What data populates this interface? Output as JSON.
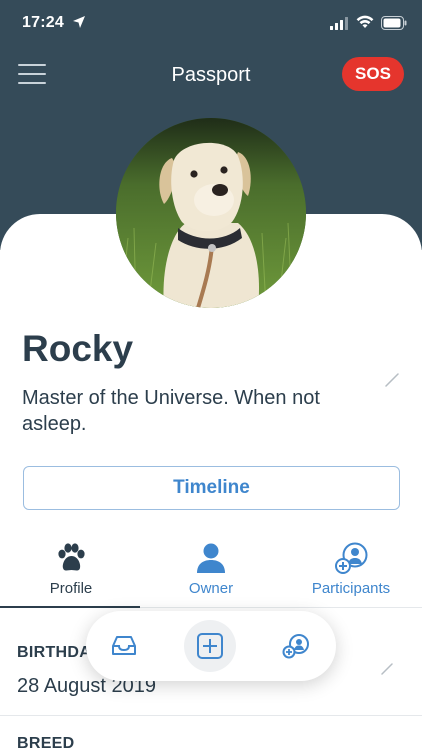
{
  "status_bar": {
    "time": "17:24"
  },
  "nav": {
    "title": "Passport",
    "sos_label": "SOS"
  },
  "pet": {
    "name": "Rocky",
    "bio": "Master of the Universe. When not asleep."
  },
  "timeline_label": "Timeline",
  "tabs": [
    {
      "label": "Profile",
      "icon": "paw-icon",
      "active": true
    },
    {
      "label": "Owner",
      "icon": "person-icon",
      "active": false
    },
    {
      "label": "Participants",
      "icon": "add-person-icon",
      "active": false
    }
  ],
  "details": {
    "birthday_label": "BIRTHDAY",
    "birthday_value": "28 August 2019",
    "breed_label": "BREED"
  },
  "floating_bar": {
    "items": [
      "inbox-icon",
      "add-square-icon",
      "add-participant-icon"
    ]
  },
  "colors": {
    "header": "#354b59",
    "accent": "#3f86cd",
    "sos": "#e5352d",
    "text_dark": "#2c3e4c"
  }
}
